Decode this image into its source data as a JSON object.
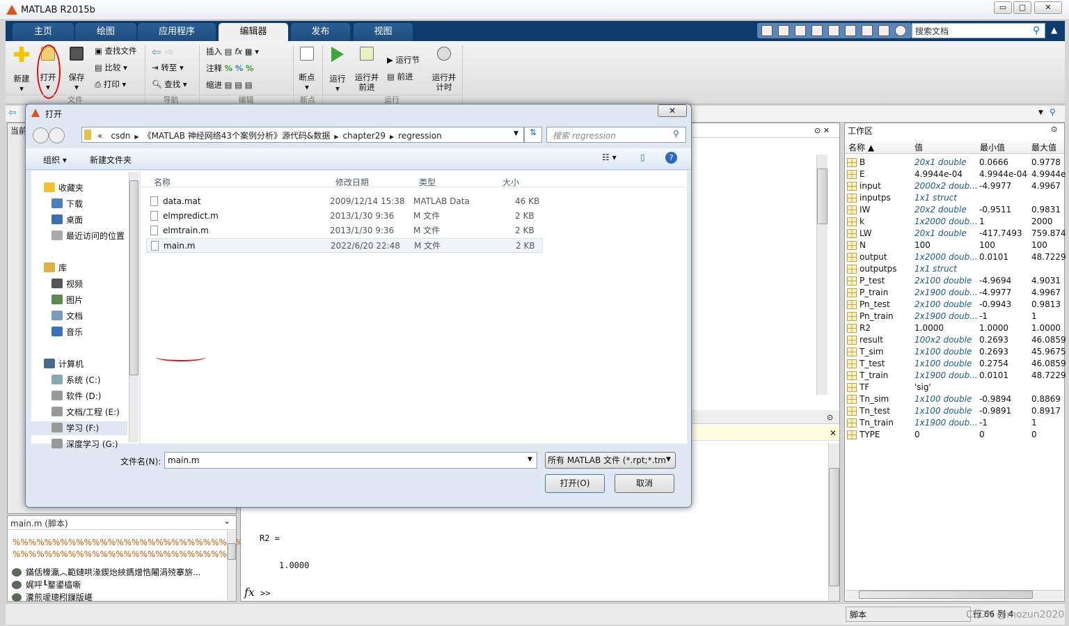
{
  "window": {
    "title": "MATLAB R2015b",
    "min": "▭",
    "max": "▢",
    "close": "✕"
  },
  "tabs": [
    {
      "label": "主页"
    },
    {
      "label": "绘图"
    },
    {
      "label": "应用程序"
    },
    {
      "label": "编辑器",
      "active": true
    },
    {
      "label": "发布"
    },
    {
      "label": "视图"
    }
  ],
  "ribbon": {
    "file": {
      "new": "新建",
      "open": "打开",
      "save": "保存",
      "find_files": "查找文件",
      "compare": "比较",
      "print": "打印",
      "group": "文件"
    },
    "nav": {
      "goto": "转至",
      "find": "查找",
      "group": "导航"
    },
    "edit": {
      "insert": "插入",
      "comment": "注释",
      "indent": "缩进",
      "group": "编辑"
    },
    "breakpoints": {
      "label": "断点",
      "group": "断点"
    },
    "run": {
      "run": "运行",
      "run_advance": "运行并\n前进",
      "run_section": "运行节",
      "advance": "前进",
      "run_time": "运行并\n计时",
      "group": "运行"
    }
  },
  "search_docs": {
    "placeholder": "搜索文档"
  },
  "left_panel": {
    "label": "当前"
  },
  "details": {
    "title": "main.m  (脚本)",
    "lines": [
      "%%%%%%%%%%%%%%%%%%%%%%%%%%%%%%",
      "%%%%%%%%%%%%%%%%%%%%%%%%%%%"
    ],
    "sections": [
      "鏋佸檺瀛︿範鏈哄湪鍥炲綊鎷熷悎闂涓殑搴旂...",
      "娓呯┖鐜鍙橀噺",
      "瀵煎叆璁粌鏁版嵁"
    ]
  },
  "command": {
    "output_var": "R2 =",
    "output_val": "1.0000",
    "prompt": ">>",
    "fx": "fx"
  },
  "workspace": {
    "title": "工作区",
    "columns": [
      "名称 ▲",
      "值",
      "最小值",
      "最大值"
    ],
    "rows": [
      {
        "name": "B",
        "value": "20x1 double",
        "min": "0.0666",
        "max": "0.9778",
        "italic": true
      },
      {
        "name": "E",
        "value": "4.9944e-04",
        "min": "4.9944e-04",
        "max": "4.9944e-04"
      },
      {
        "name": "input",
        "value": "2000x2 doub...",
        "min": "-4.9977",
        "max": "4.9967",
        "italic": true
      },
      {
        "name": "inputps",
        "value": "1x1 struct",
        "min": "",
        "max": "",
        "italic": true,
        "type": "struct"
      },
      {
        "name": "IW",
        "value": "20x2 double",
        "min": "-0.9511",
        "max": "0.9831",
        "italic": true
      },
      {
        "name": "k",
        "value": "1x2000 doub...",
        "min": "1",
        "max": "2000",
        "italic": true
      },
      {
        "name": "LW",
        "value": "20x1 double",
        "min": "-417.7493",
        "max": "759.8748",
        "italic": true
      },
      {
        "name": "N",
        "value": "100",
        "min": "100",
        "max": "100"
      },
      {
        "name": "output",
        "value": "1x2000 doub...",
        "min": "0.0101",
        "max": "48.7229",
        "italic": true
      },
      {
        "name": "outputps",
        "value": "1x1 struct",
        "min": "",
        "max": "",
        "italic": true,
        "type": "struct"
      },
      {
        "name": "P_test",
        "value": "2x100 double",
        "min": "-4.9694",
        "max": "4.9031",
        "italic": true
      },
      {
        "name": "P_train",
        "value": "2x1900 doub...",
        "min": "-4.9977",
        "max": "4.9967",
        "italic": true
      },
      {
        "name": "Pn_test",
        "value": "2x100 double",
        "min": "-0.9943",
        "max": "0.9813",
        "italic": true
      },
      {
        "name": "Pn_train",
        "value": "2x1900 doub...",
        "min": "-1",
        "max": "1",
        "italic": true
      },
      {
        "name": "R2",
        "value": "1.0000",
        "min": "1.0000",
        "max": "1.0000"
      },
      {
        "name": "result",
        "value": "100x2 double",
        "min": "0.2693",
        "max": "46.0859",
        "italic": true
      },
      {
        "name": "T_sim",
        "value": "1x100 double",
        "min": "0.2693",
        "max": "45.9675",
        "italic": true
      },
      {
        "name": "T_test",
        "value": "1x100 double",
        "min": "0.2754",
        "max": "46.0859",
        "italic": true
      },
      {
        "name": "T_train",
        "value": "1x1900 doub...",
        "min": "0.0101",
        "max": "48.7229",
        "italic": true
      },
      {
        "name": "TF",
        "value": "'sig'",
        "min": "",
        "max": "",
        "type": "char"
      },
      {
        "name": "Tn_sim",
        "value": "1x100 double",
        "min": "-0.9894",
        "max": "0.8869",
        "italic": true
      },
      {
        "name": "Tn_test",
        "value": "1x100 double",
        "min": "-0.9891",
        "max": "0.8917",
        "italic": true
      },
      {
        "name": "Tn_train",
        "value": "1x1900 doub...",
        "min": "-1",
        "max": "1",
        "italic": true
      },
      {
        "name": "TYPE",
        "value": "0",
        "min": "0",
        "max": "0"
      }
    ]
  },
  "status": {
    "mode": "脚本",
    "row_label": "行",
    "row": "66",
    "col_label": "列",
    "col": "4",
    "watermark": "CSDN @mozun2020"
  },
  "dialog": {
    "title": "打开",
    "close": "✕",
    "breadcrumb": [
      "«",
      "csdn",
      "《MATLAB 神经网络43个案例分析》源代码&数据",
      "chapter29",
      "regression"
    ],
    "search_placeholder": "搜索 regression",
    "organize": "组织 ▾",
    "new_folder": "新建文件夹",
    "nav": [
      {
        "label": "收藏夹",
        "c": "#f2c12e"
      },
      {
        "label": "下载",
        "c": "#4a7fc0",
        "sub": true
      },
      {
        "label": "桌面",
        "c": "#3a6fb0",
        "sub": true
      },
      {
        "label": "最近访问的位置",
        "c": "#aaa",
        "sub": true
      },
      {
        "label": "库",
        "c": "#e0b040",
        "gap": true
      },
      {
        "label": "视频",
        "c": "#555",
        "sub": true
      },
      {
        "label": "图片",
        "c": "#5a8a50",
        "sub": true
      },
      {
        "label": "文档",
        "c": "#7a9ac0",
        "sub": true
      },
      {
        "label": "音乐",
        "c": "#3a70c0",
        "sub": true
      },
      {
        "label": "计算机",
        "c": "#4a6a90",
        "gap": true
      },
      {
        "label": "系统 (C:)",
        "c": "#8aa",
        "sub": true
      },
      {
        "label": "软件 (D:)",
        "c": "#999",
        "sub": true
      },
      {
        "label": "文档/工程 (E:)",
        "c": "#999",
        "sub": true
      },
      {
        "label": "学习 (F:)",
        "c": "#999",
        "sub": true,
        "selected": true
      },
      {
        "label": "深度学习 (G:)",
        "c": "#999",
        "sub": true
      }
    ],
    "columns": [
      "名称",
      "修改日期",
      "类型",
      "大小"
    ],
    "files": [
      {
        "name": "data.mat",
        "date": "2009/12/14 15:38",
        "type": "MATLAB Data",
        "size": "46 KB"
      },
      {
        "name": "elmpredict.m",
        "date": "2013/1/30 9:36",
        "type": "M 文件",
        "size": "2 KB"
      },
      {
        "name": "elmtrain.m",
        "date": "2013/1/30 9:36",
        "type": "M 文件",
        "size": "2 KB"
      },
      {
        "name": "main.m",
        "date": "2022/6/20 22:48",
        "type": "M 文件",
        "size": "2 KB",
        "selected": true
      }
    ],
    "filename_label": "文件名(N):",
    "filename_value": "main.m",
    "filter": "所有 MATLAB 文件 (*.rpt;*.tm",
    "open_button": "打开(O)",
    "cancel_button": "取消"
  },
  "colors": {
    "tab_bg": "#0d3b6e",
    "annotation": "#e01010",
    "italic_value": "#1a5a9a"
  }
}
